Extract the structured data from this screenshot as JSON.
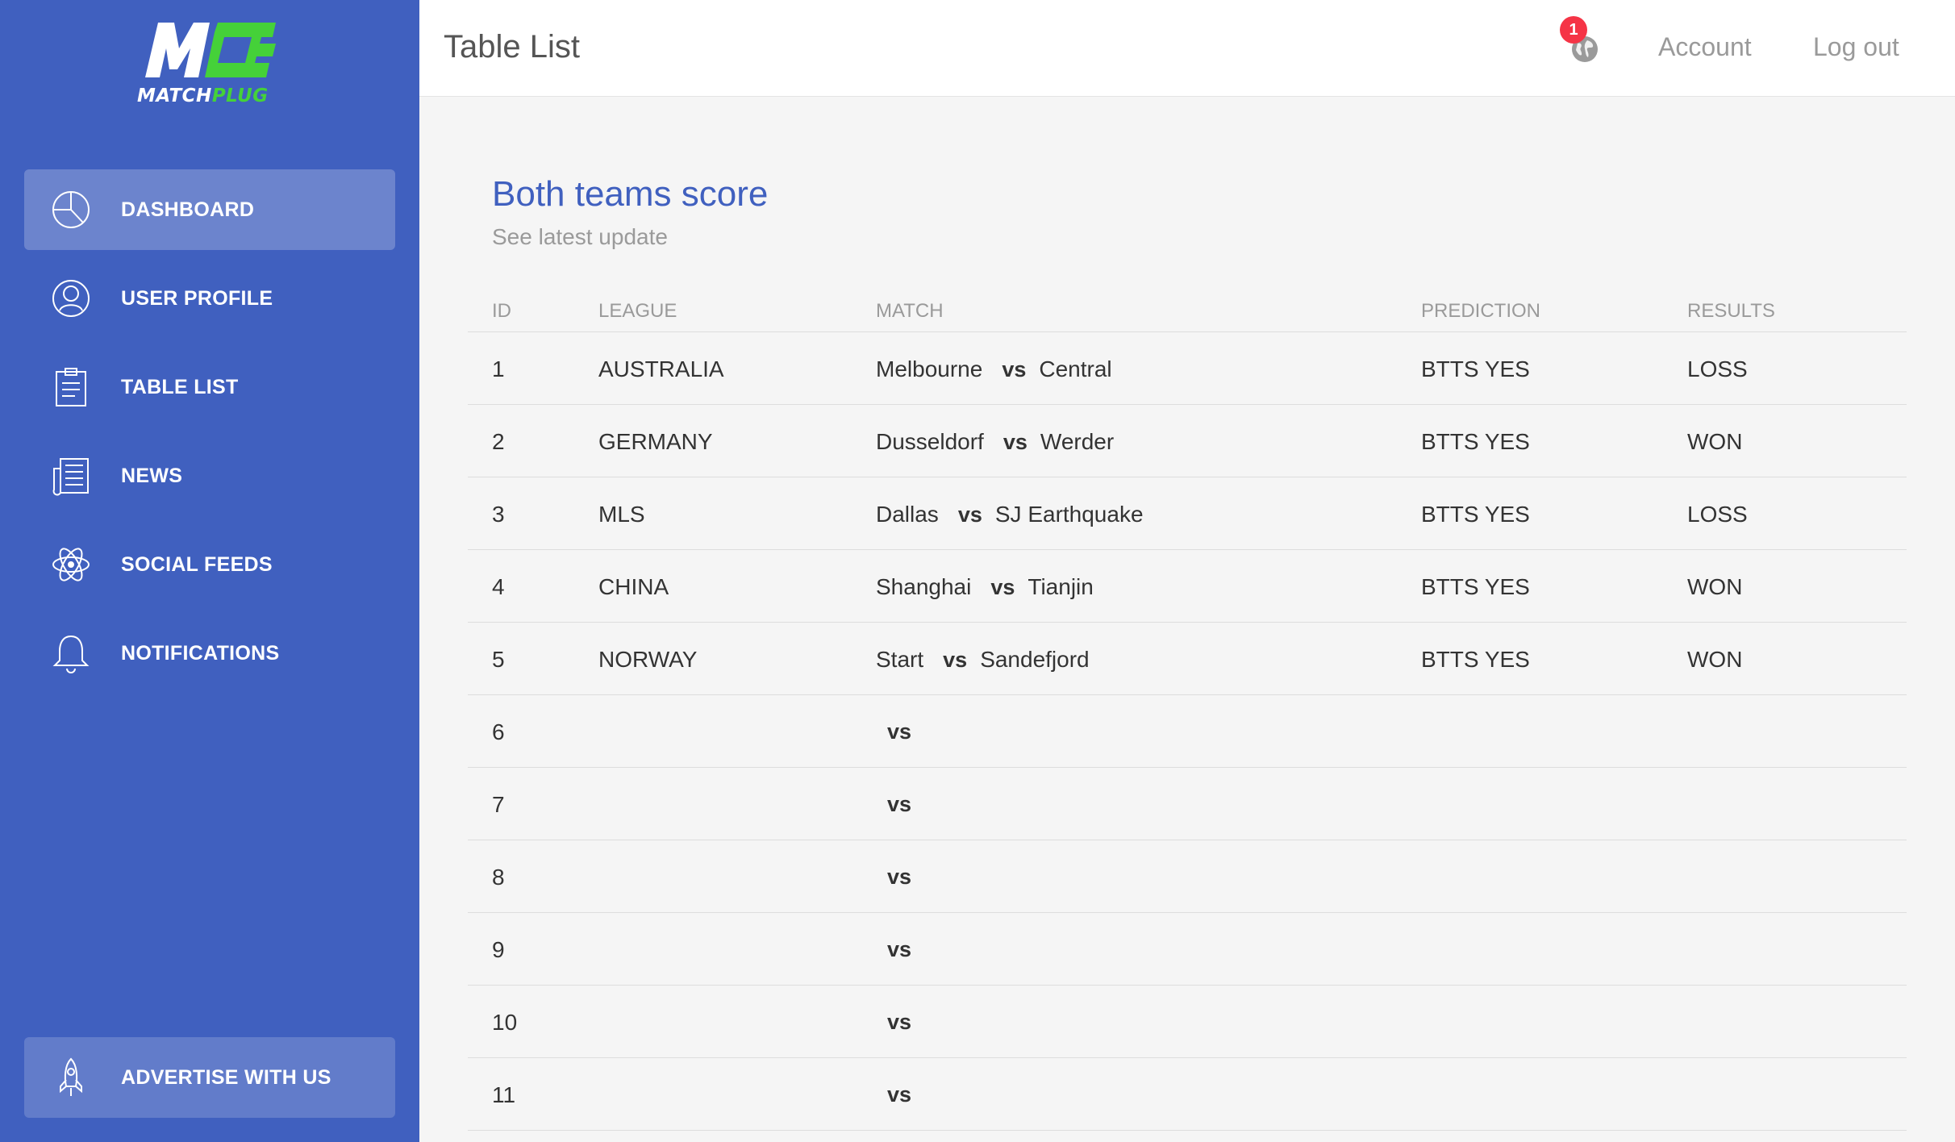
{
  "brand": {
    "logo_letters": "MC",
    "name_part1": "MATCH",
    "name_part2": "PLUG",
    "primary_color": "#4060bf",
    "accent_color": "#45d139"
  },
  "sidebar": {
    "items": [
      {
        "label": "DASHBOARD",
        "icon": "pie-chart-icon",
        "active": true
      },
      {
        "label": "USER PROFILE",
        "icon": "user-icon",
        "active": false
      },
      {
        "label": "TABLE LIST",
        "icon": "clipboard-icon",
        "active": false
      },
      {
        "label": "NEWS",
        "icon": "newspaper-icon",
        "active": false
      },
      {
        "label": "SOCIAL FEEDS",
        "icon": "atom-icon",
        "active": false
      },
      {
        "label": "NOTIFICATIONS",
        "icon": "bell-icon",
        "active": false
      }
    ],
    "advertise": {
      "label": "ADVERTISE WITH US",
      "icon": "rocket-icon"
    }
  },
  "topbar": {
    "title": "Table List",
    "notification_count": "1",
    "account_label": "Account",
    "logout_label": "Log out"
  },
  "card": {
    "title": "Both teams score",
    "subtitle": "See latest update"
  },
  "table": {
    "columns": [
      "ID",
      "LEAGUE",
      "MATCH",
      "PREDICTION",
      "RESULTS"
    ],
    "vs_label": "vs",
    "rows": [
      {
        "id": "1",
        "league": "AUSTRALIA",
        "home": "Melbourne",
        "away": "Central",
        "prediction": "BTTS YES",
        "result": "LOSS"
      },
      {
        "id": "2",
        "league": "GERMANY",
        "home": "Dusseldorf",
        "away": "Werder",
        "prediction": "BTTS YES",
        "result": "WON"
      },
      {
        "id": "3",
        "league": "MLS",
        "home": "Dallas",
        "away": "SJ Earthquake",
        "prediction": "BTTS YES",
        "result": "LOSS"
      },
      {
        "id": "4",
        "league": "CHINA",
        "home": "Shanghai",
        "away": "Tianjin",
        "prediction": "BTTS YES",
        "result": "WON"
      },
      {
        "id": "5",
        "league": "NORWAY",
        "home": "Start",
        "away": "Sandefjord",
        "prediction": "BTTS YES",
        "result": "WON"
      },
      {
        "id": "6",
        "league": "",
        "home": "",
        "away": "",
        "prediction": "",
        "result": ""
      },
      {
        "id": "7",
        "league": "",
        "home": "",
        "away": "",
        "prediction": "",
        "result": ""
      },
      {
        "id": "8",
        "league": "",
        "home": "",
        "away": "",
        "prediction": "",
        "result": ""
      },
      {
        "id": "9",
        "league": "",
        "home": "",
        "away": "",
        "prediction": "",
        "result": ""
      },
      {
        "id": "10",
        "league": "",
        "home": "",
        "away": "",
        "prediction": "",
        "result": ""
      },
      {
        "id": "11",
        "league": "",
        "home": "",
        "away": "",
        "prediction": "",
        "result": ""
      }
    ]
  }
}
